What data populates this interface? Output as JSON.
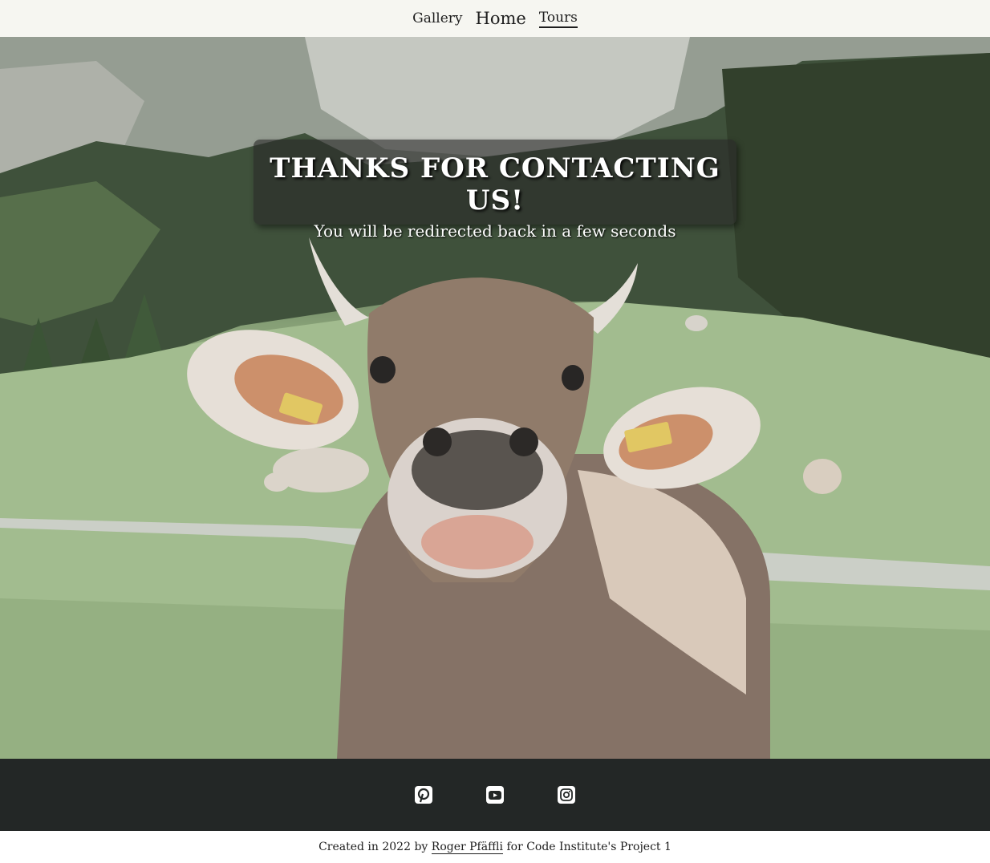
{
  "nav": {
    "gallery": "Gallery",
    "home": "Home",
    "tours": "Tours"
  },
  "hero": {
    "image": "cow-portrait-in-alpine-meadow",
    "title": "THANKS FOR CONTACTING US!",
    "subtitle": "You will be redirected back in a few seconds"
  },
  "footer": {
    "social": [
      "pinterest-icon",
      "youtube-icon",
      "instagram-icon"
    ],
    "credit_prefix": "Created in 2022 by",
    "credit_author": "Roger Pfäffli",
    "credit_suffix": "for Code Institute's Project 1"
  },
  "colors": {
    "nav_bg": "#f6f6f1",
    "footer_bg": "#232726",
    "message_bg": "rgba(40,40,40,0.62)"
  }
}
